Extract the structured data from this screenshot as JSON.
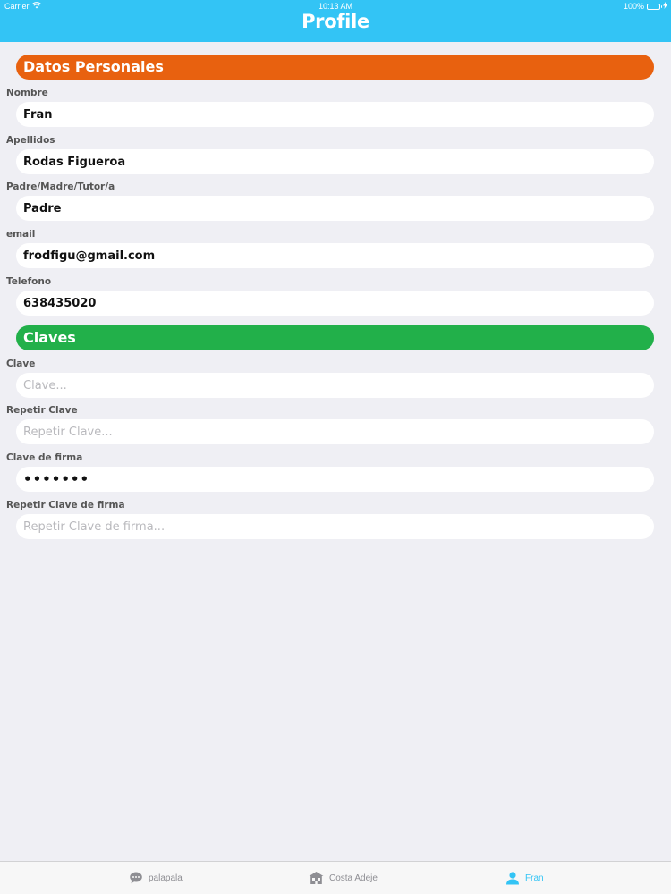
{
  "status_bar": {
    "carrier": "Carrier",
    "time": "10:13 AM",
    "battery": "100%"
  },
  "nav": {
    "title": "Profile"
  },
  "sections": {
    "personal": {
      "title": "Datos Personales",
      "color": "#e8610f",
      "fields": [
        {
          "label": "Nombre",
          "value": "Fran"
        },
        {
          "label": "Apellidos",
          "value": "Rodas Figueroa"
        },
        {
          "label": "Padre/Madre/Tutor/a",
          "value": "Padre"
        },
        {
          "label": "email",
          "value": "frodfigu@gmail.com"
        },
        {
          "label": "Telefono",
          "value": "638435020"
        }
      ]
    },
    "keys": {
      "title": "Claves",
      "color": "#22b04a",
      "fields": [
        {
          "label": "Clave",
          "value": "",
          "placeholder": "Clave..."
        },
        {
          "label": "Repetir Clave",
          "value": "",
          "placeholder": "Repetir Clave..."
        },
        {
          "label": "Clave de firma",
          "value": "•••••••",
          "placeholder": ""
        },
        {
          "label": "Repetir Clave de firma",
          "value": "",
          "placeholder": "Repetir Clave de firma..."
        }
      ]
    }
  },
  "tabbar": {
    "items": [
      {
        "label": "palapala",
        "icon": "chat-bubble-icon",
        "active": false
      },
      {
        "label": "Costa Adeje",
        "icon": "school-icon",
        "active": false
      },
      {
        "label": "Fran",
        "icon": "person-icon",
        "active": true
      }
    ]
  },
  "colors": {
    "nav_background": "#33c4f5",
    "background": "#efeff4",
    "tab_active": "#33c4f5",
    "tab_inactive": "#8e8e93"
  }
}
